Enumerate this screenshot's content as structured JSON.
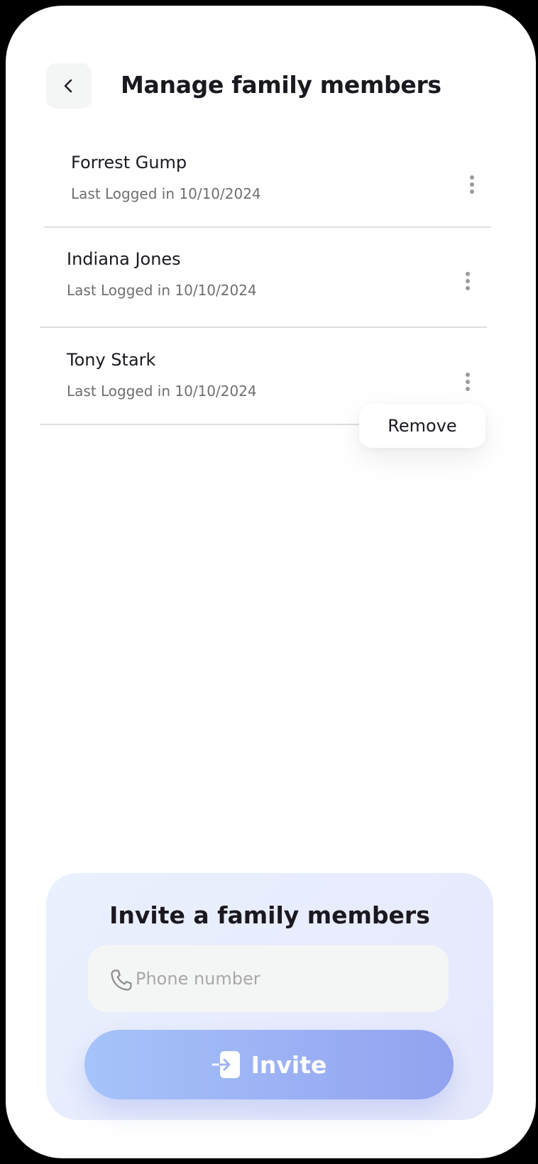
{
  "header": {
    "title": "Manage family members",
    "back_icon": "chevron-left-icon"
  },
  "members": [
    {
      "name": "Forrest Gump",
      "last_login": "Last Logged in 10/10/2024"
    },
    {
      "name": "Indiana Jones",
      "last_login": "Last Logged in 10/10/2024"
    },
    {
      "name": "Tony Stark",
      "last_login": "Last Logged in 10/10/2024"
    }
  ],
  "context_menu": {
    "remove_label": "Remove"
  },
  "invite": {
    "title": "Invite a family members",
    "phone_placeholder": "Phone number",
    "phone_value": "",
    "button_label": "Invite",
    "phone_icon": "phone-icon",
    "button_icon": "login-arrow-icon"
  },
  "colors": {
    "text_primary": "#1b1820",
    "text_secondary": "#6f6f6f",
    "invite_gradient_start": "#a6c3fa",
    "invite_gradient_end": "#92a2ef",
    "card_background": "#eaf0fe"
  }
}
